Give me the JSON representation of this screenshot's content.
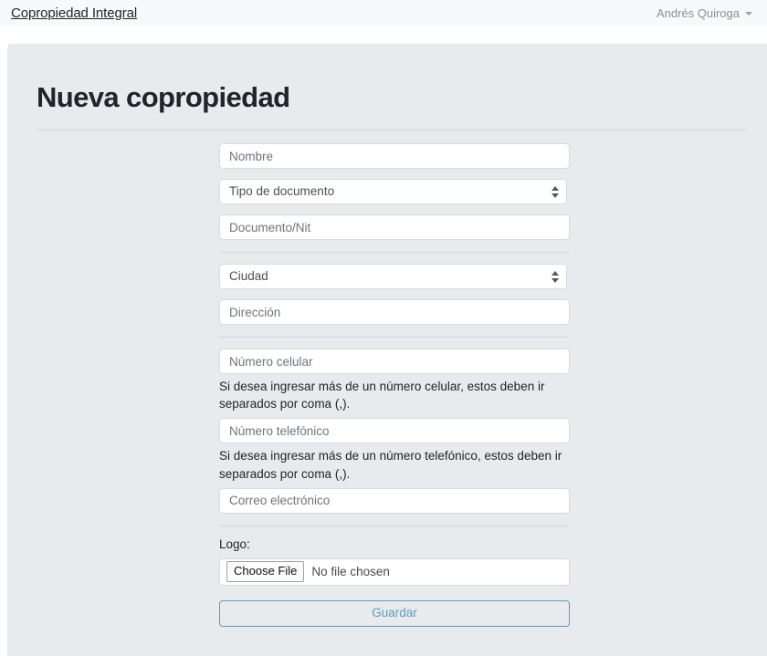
{
  "navbar": {
    "brand": "Copropiedad Integral",
    "user_name": "Andrés Quiroga",
    "caret_icon": "chevron-down-icon"
  },
  "page": {
    "title": "Nueva copropiedad"
  },
  "form": {
    "fields": {
      "nombre": {
        "placeholder": "Nombre",
        "value": ""
      },
      "tipo_documento": {
        "selected": "Tipo de documento",
        "stepper_icon": "up-down-stepper-icon"
      },
      "documento_nit": {
        "placeholder": "Documento/Nit",
        "value": ""
      },
      "ciudad": {
        "selected": "Ciudad",
        "stepper_icon": "up-down-stepper-icon"
      },
      "direccion": {
        "placeholder": "Dirección",
        "value": ""
      },
      "numero_celular": {
        "placeholder": "Número celular",
        "value": ""
      },
      "numero_telefonico": {
        "placeholder": "Número telefónico",
        "value": ""
      },
      "correo_electronico": {
        "placeholder": "Correo electrónico",
        "value": ""
      }
    },
    "help": {
      "celular": "Si desea ingresar más de un número celular, estos deben ir separados por coma (,).",
      "telefonico": "Si desea ingresar más de un número telefónico, estos deben ir separados por coma (,)."
    },
    "logo": {
      "label": "Logo:",
      "choose_button": "Choose File",
      "file_status": "No file chosen"
    },
    "submit_label": "Guardar"
  },
  "colors": {
    "navbar_bg": "#f8f9fa",
    "panel_bg": "#e8eaed",
    "text_primary": "#212529",
    "text_muted": "#6c757d",
    "input_border": "#d8dbdf",
    "divider": "#d3d6da",
    "accent": "#5a9fb8"
  }
}
